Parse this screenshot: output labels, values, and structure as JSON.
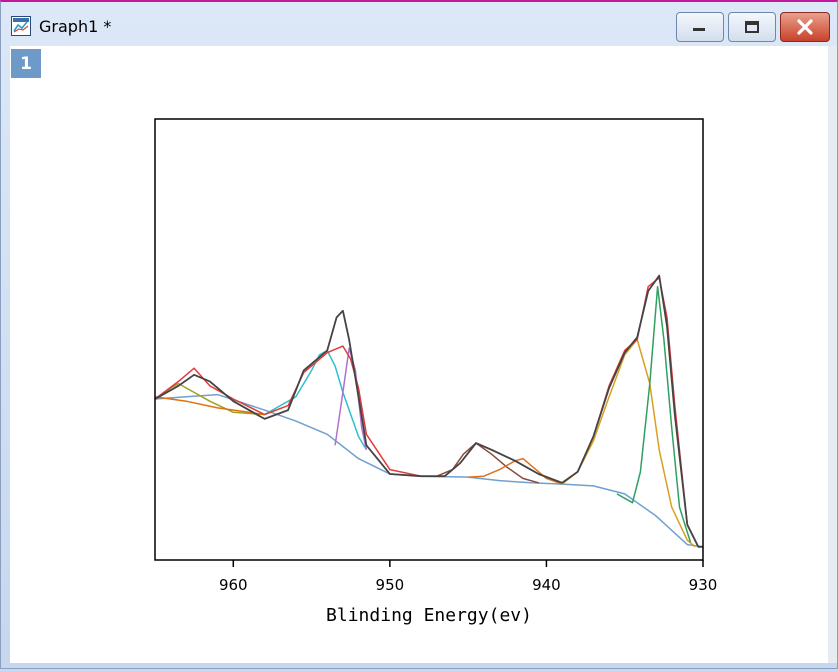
{
  "window": {
    "title": "Graph1 *",
    "icon": "graph-window-icon",
    "layer_label": "1",
    "buttons": {
      "minimize": "minimize-icon",
      "maximize": "maximize-icon",
      "close": "close-icon"
    }
  },
  "colors": {
    "raw": "#e03c3c",
    "envelope": "#444444",
    "background": "#6fa0d0",
    "peaks": [
      "#a0a020",
      "#e07010",
      "#30c0cc",
      "#b070d0",
      "#8a4a3a",
      "#e07020",
      "#d8a020",
      "#30a060"
    ]
  },
  "chart_data": {
    "type": "line",
    "title": "",
    "xlabel": "Blinding Energy(ev)",
    "ylabel": "",
    "xlim": [
      965,
      930
    ],
    "x_reversed": true,
    "ylim": [
      0,
      1
    ],
    "xticks": [
      960,
      950,
      940,
      930
    ],
    "xtick_labels": [
      "960",
      "950",
      "940",
      "930"
    ],
    "grid": false,
    "legend": "none",
    "series": [
      {
        "x": [
          965,
          963.5,
          962.5,
          961.5,
          960,
          958,
          956.5,
          955.5,
          954,
          953,
          952.5,
          952,
          951.5,
          950,
          948,
          946.5,
          945.5,
          944.5,
          943.5,
          942,
          940.5,
          939,
          938,
          937,
          936,
          935,
          934.2,
          933.5,
          932.8,
          932.3,
          931.8,
          931,
          930.3,
          930
        ],
        "y": [
          0.365,
          0.405,
          0.435,
          0.395,
          0.365,
          0.33,
          0.35,
          0.425,
          0.47,
          0.485,
          0.455,
          0.39,
          0.285,
          0.205,
          0.19,
          0.19,
          0.22,
          0.265,
          0.25,
          0.225,
          0.195,
          0.175,
          0.2,
          0.28,
          0.395,
          0.475,
          0.5,
          0.62,
          0.64,
          0.55,
          0.35,
          0.08,
          0.03,
          0.03
        ]
      },
      {
        "x": [
          965,
          963.5,
          962.5,
          961.5,
          960,
          958,
          956.5,
          955.5,
          954,
          953.4,
          953,
          952.6,
          952,
          951.5,
          950,
          948,
          946.5,
          945.5,
          944.5,
          943.5,
          942,
          940.5,
          939,
          938,
          937,
          936,
          935,
          934.2,
          933.5,
          932.8,
          932.3,
          931.8,
          931,
          930.3,
          930
        ],
        "y": [
          0.365,
          0.395,
          0.42,
          0.405,
          0.36,
          0.32,
          0.34,
          0.43,
          0.475,
          0.55,
          0.565,
          0.5,
          0.37,
          0.26,
          0.195,
          0.19,
          0.19,
          0.22,
          0.265,
          0.25,
          0.225,
          0.195,
          0.175,
          0.2,
          0.28,
          0.39,
          0.47,
          0.505,
          0.61,
          0.645,
          0.53,
          0.33,
          0.08,
          0.03,
          0.03
        ]
      },
      {
        "x": [
          965,
          963,
          961,
          958,
          956,
          954,
          952,
          950,
          948,
          945,
          943,
          941,
          939,
          937,
          935,
          933,
          931,
          930
        ],
        "y": [
          0.365,
          0.37,
          0.375,
          0.34,
          0.315,
          0.285,
          0.23,
          0.195,
          0.19,
          0.188,
          0.18,
          0.175,
          0.172,
          0.168,
          0.15,
          0.1,
          0.035,
          0.03
        ]
      },
      {
        "x": [
          965,
          964,
          963.5,
          962.5,
          961.5,
          960,
          958
        ],
        "y": [
          0.365,
          0.39,
          0.4,
          0.38,
          0.36,
          0.335,
          0.33
        ]
      },
      {
        "x": [
          965,
          963,
          961,
          959,
          958
        ],
        "y": [
          0.37,
          0.36,
          0.345,
          0.335,
          0.33
        ]
      },
      {
        "x": [
          958,
          956,
          955,
          954.5,
          954,
          953.5,
          953,
          952,
          951.5
        ],
        "y": [
          0.33,
          0.37,
          0.43,
          0.465,
          0.475,
          0.44,
          0.38,
          0.28,
          0.25
        ]
      },
      {
        "x": [
          953.5,
          953,
          952.6,
          952.2,
          951.8,
          951.5
        ],
        "y": [
          0.26,
          0.38,
          0.48,
          0.43,
          0.3,
          0.25
        ]
      },
      {
        "x": [
          947,
          946,
          945.3,
          944.5,
          943.5,
          942.5,
          941.5,
          940.5
        ],
        "y": [
          0.19,
          0.205,
          0.24,
          0.265,
          0.24,
          0.21,
          0.185,
          0.175
        ]
      },
      {
        "x": [
          945,
          944,
          943,
          942,
          941.5,
          941,
          940,
          939
        ],
        "y": [
          0.188,
          0.19,
          0.205,
          0.225,
          0.23,
          0.215,
          0.185,
          0.172
        ]
      },
      {
        "x": [
          939,
          938,
          937,
          936,
          935,
          934.2,
          933.4,
          932.8,
          932,
          931,
          930.5
        ],
        "y": [
          0.172,
          0.2,
          0.27,
          0.37,
          0.465,
          0.5,
          0.4,
          0.25,
          0.12,
          0.045,
          0.03
        ]
      },
      {
        "x": [
          935.5,
          934.5,
          934,
          933.4,
          932.9,
          932.5,
          932,
          931.5,
          930.8
        ],
        "y": [
          0.15,
          0.13,
          0.2,
          0.4,
          0.62,
          0.5,
          0.3,
          0.12,
          0.04
        ]
      }
    ]
  }
}
